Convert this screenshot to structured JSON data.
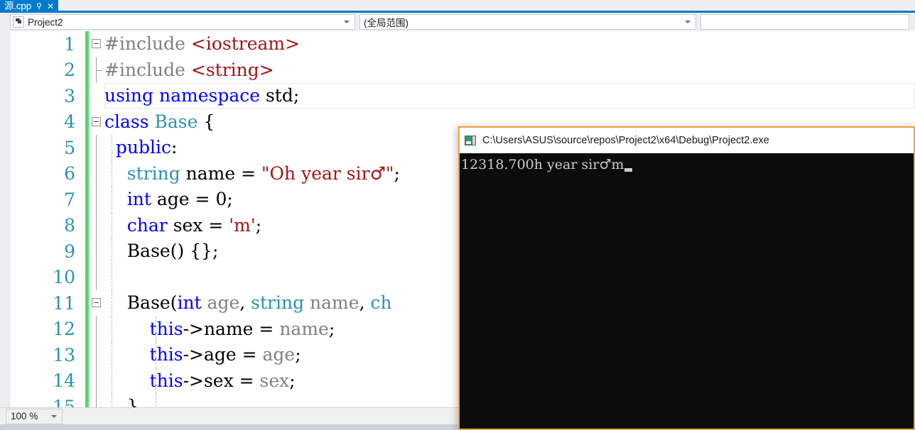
{
  "tab": {
    "title": "源.cpp",
    "pin_icon": "pin-icon",
    "close_icon": "close-icon"
  },
  "navbar": {
    "project_combo": {
      "value": "Project2",
      "icon": "project-icon",
      "arrow": "chevron-down-icon"
    },
    "scope_combo": {
      "value": "(全局范围)",
      "arrow": "chevron-down-icon"
    },
    "member_combo": {
      "value": "",
      "arrow": "chevron-down-icon"
    }
  },
  "editor": {
    "lines": [
      {
        "n": "1",
        "text": "#include <iostream>"
      },
      {
        "n": "2",
        "text": "#include <string>"
      },
      {
        "n": "3",
        "text": "using namespace std;"
      },
      {
        "n": "4",
        "text": "class Base {"
      },
      {
        "n": "5",
        "text": "public:"
      },
      {
        "n": "6",
        "text": "    string name = \"Oh year sir♂\";"
      },
      {
        "n": "7",
        "text": "    int age = 0;"
      },
      {
        "n": "8",
        "text": "    char sex = 'm';"
      },
      {
        "n": "9",
        "text": "    Base() {};"
      },
      {
        "n": "10",
        "text": ""
      },
      {
        "n": "11",
        "text": "    Base(int age, string name, char sex) {"
      },
      {
        "n": "12",
        "text": "        this->name = name;"
      },
      {
        "n": "13",
        "text": "        this->age = age;"
      },
      {
        "n": "14",
        "text": "        this->sex = sex;"
      },
      {
        "n": "15",
        "text": "    }"
      }
    ],
    "tokens": {
      "l1": [
        {
          "t": "#include ",
          "c": "id"
        },
        {
          "t": "<iostream>",
          "c": "str"
        }
      ],
      "l2": [
        {
          "t": "#include ",
          "c": "id"
        },
        {
          "t": "<string>",
          "c": "str"
        }
      ],
      "l3": [
        {
          "t": "using namespace ",
          "c": "kw"
        },
        {
          "t": "std;",
          "c": "plain"
        }
      ],
      "l4": [
        {
          "t": "class ",
          "c": "kw"
        },
        {
          "t": "Base",
          "c": "type"
        },
        {
          "t": " {",
          "c": "plain"
        }
      ],
      "l5": [
        {
          "t": "public",
          "c": "kw"
        },
        {
          "t": ":",
          "c": "plain"
        }
      ],
      "l6": [
        {
          "t": "string",
          "c": "type"
        },
        {
          "t": " name = ",
          "c": "plain"
        },
        {
          "t": "\"Oh year sir♂\"",
          "c": "str"
        }
      ],
      "l7": [
        {
          "t": "int",
          "c": "kw"
        },
        {
          "t": " age = 0;",
          "c": "plain"
        }
      ],
      "l8": [
        {
          "t": "char",
          "c": "kw"
        },
        {
          "t": " sex = ",
          "c": "plain"
        },
        {
          "t": "'m'",
          "c": "str"
        },
        {
          "t": ";",
          "c": "plain"
        }
      ],
      "l9": [
        {
          "t": "Base() {};",
          "c": "plain"
        }
      ],
      "l11": [
        {
          "t": "Base(",
          "c": "plain"
        },
        {
          "t": "int",
          "c": "kw"
        },
        {
          "t": " age",
          "c": "id"
        },
        {
          "t": ", ",
          "c": "plain"
        },
        {
          "t": "string",
          "c": "type"
        },
        {
          "t": " name",
          "c": "id"
        },
        {
          "t": ", ",
          "c": "plain"
        },
        {
          "t": "ch",
          "c": "type"
        }
      ],
      "l12": [
        {
          "t": "this",
          "c": "kw"
        },
        {
          "t": "->name = ",
          "c": "plain"
        },
        {
          "t": "name",
          "c": "id"
        },
        {
          "t": ";",
          "c": "plain"
        }
      ],
      "l13": [
        {
          "t": "this",
          "c": "kw"
        },
        {
          "t": "->age = ",
          "c": "plain"
        },
        {
          "t": "age",
          "c": "id"
        },
        {
          "t": ";",
          "c": "plain"
        }
      ],
      "l14": [
        {
          "t": "this",
          "c": "kw"
        },
        {
          "t": "->sex = ",
          "c": "plain"
        },
        {
          "t": "sex",
          "c": "id"
        },
        {
          "t": ";",
          "c": "plain"
        }
      ],
      "l15": [
        {
          "t": "}",
          "c": "plain"
        }
      ]
    },
    "colors": {
      "keyword": "#0000ff",
      "type": "#2b91af",
      "string": "#a31515",
      "identifier": "#808080",
      "linenumber": "#2b91af",
      "changebar": "#57d572"
    }
  },
  "statusbar": {
    "zoom": "100 %",
    "zoom_arrow": "chevron-down-icon"
  },
  "console": {
    "title": "C:\\Users\\ASUS\\source\\repos\\Project2\\x64\\Debug\\Project2.exe",
    "icon": "console-icon",
    "output": "12318.700h year sir♂m",
    "border_color": "#e8a33d",
    "background": "#0c0c0c"
  }
}
